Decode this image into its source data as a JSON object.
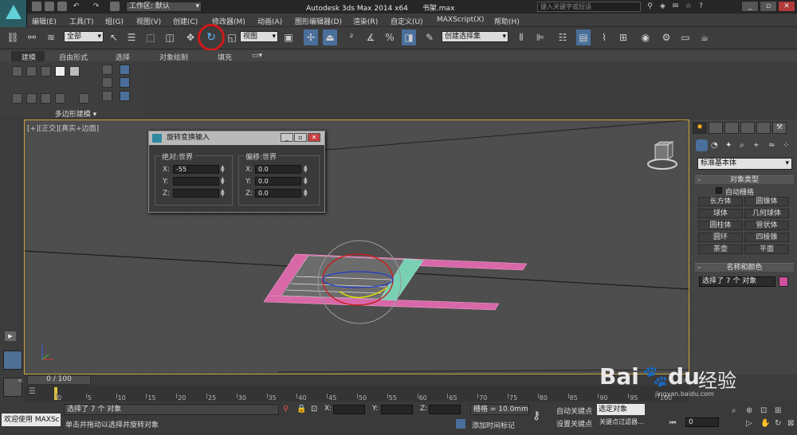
{
  "app": {
    "title": "Autodesk 3ds Max  2014 x64",
    "file": "书架.max",
    "workspace": "工作区: 默认",
    "search_placeholder": "键入关键字或短语"
  },
  "menu": [
    "编辑(E)",
    "工具(T)",
    "组(G)",
    "视图(V)",
    "创建(C)",
    "修改器(M)",
    "动画(A)",
    "图形编辑器(D)",
    "渲染(R)",
    "自定义(U)",
    "MAXScript(X)",
    "帮助(H)"
  ],
  "toolbar": {
    "filter": "全部",
    "ref_coord": "视图",
    "named_selection": "创建选择集"
  },
  "ribbon": {
    "tabs": [
      "建模",
      "自由形式",
      "选择",
      "对象绘制",
      "填充"
    ],
    "footer": "多边形建模"
  },
  "viewport": {
    "label": "[+][正交][真实+边面]"
  },
  "dialog": {
    "title": "旋转变换输入",
    "absolute": {
      "label": "绝对:世界",
      "x": "-55",
      "y": "",
      "z": ""
    },
    "offset": {
      "label": "偏移:世界",
      "x": "0.0",
      "y": "0.0",
      "z": "0.0"
    }
  },
  "command_panel": {
    "category": "标准基本体",
    "object_type_title": "对象类型",
    "autogrid": "自动栅格",
    "buttons": [
      "长方体",
      "圆锥体",
      "球体",
      "几何球体",
      "圆柱体",
      "管状体",
      "圆环",
      "四棱锥",
      "茶壶",
      "平面"
    ],
    "name_color_title": "名称和颜色",
    "name_value": "选择了 7 个 对象",
    "swatch_color": "#d04f9a"
  },
  "timeline": {
    "position": "0 / 100",
    "ticks": [
      "0",
      "5",
      "10",
      "15",
      "20",
      "25",
      "30",
      "35",
      "40",
      "45",
      "50",
      "55",
      "60",
      "65",
      "70",
      "75",
      "80",
      "85",
      "90",
      "95",
      "100"
    ]
  },
  "status": {
    "welcome": "欢迎使用 MAXSc",
    "selection": "选择了 7 个 对象",
    "prompt": "单击并拖动以选择并旋转对象",
    "grid": "栅格 = 10.0mm",
    "add_time_tag": "添加时间标记",
    "auto_key": "自动关键点",
    "set_key": "设置关键点",
    "selected": "选定对象",
    "key_filters": "关键点过滤器...",
    "frame": "0"
  },
  "watermark": {
    "brand": "Bai",
    "brand2": "du",
    "tail": "经验",
    "url": "jingyan.baidu.com"
  }
}
